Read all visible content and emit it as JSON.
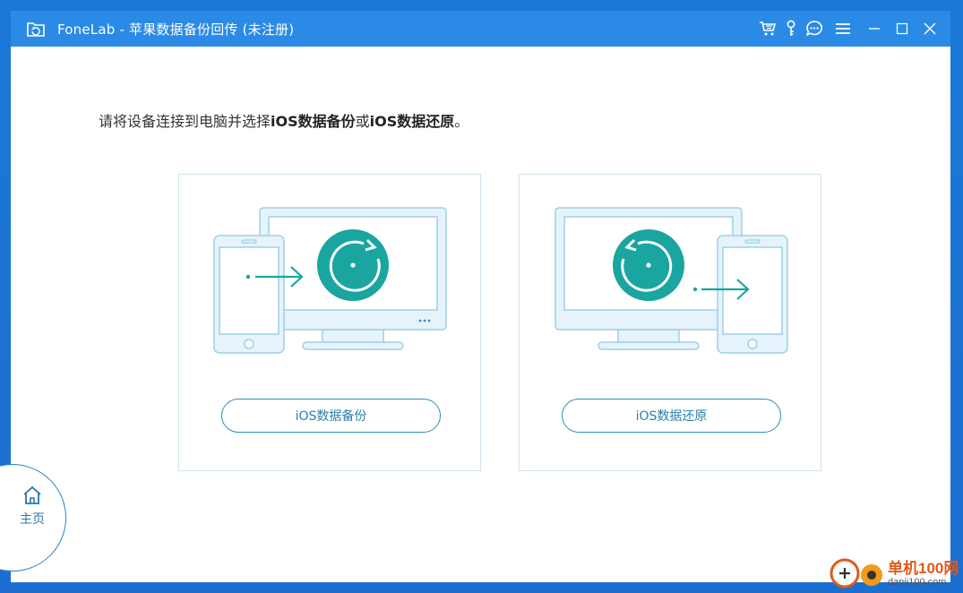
{
  "window": {
    "title": "FoneLab - 苹果数据备份回传 (未注册)",
    "icons": [
      "app-folder-icon",
      "cart-icon",
      "key-icon",
      "chat-icon",
      "menu-icon",
      "minimize-icon",
      "maximize-icon",
      "close-icon"
    ]
  },
  "main": {
    "prompt_pre": "请将设备连接到电脑并选择",
    "prompt_b1": "iOS数据备份",
    "prompt_mid": "或",
    "prompt_b2": "iOS数据还原",
    "prompt_end": "。",
    "cards": [
      {
        "button_label": "iOS数据备份",
        "icon": "backup-illustration"
      },
      {
        "button_label": "iOS数据还原",
        "icon": "restore-illustration"
      }
    ]
  },
  "nav": {
    "home_label": "主页"
  },
  "watermark": {
    "line1": "单机100网",
    "line2": "danji100.com"
  },
  "colors": {
    "titlebar": "#2b8ae6",
    "accent": "#1aa5a0",
    "border": "#2d8fb5"
  }
}
